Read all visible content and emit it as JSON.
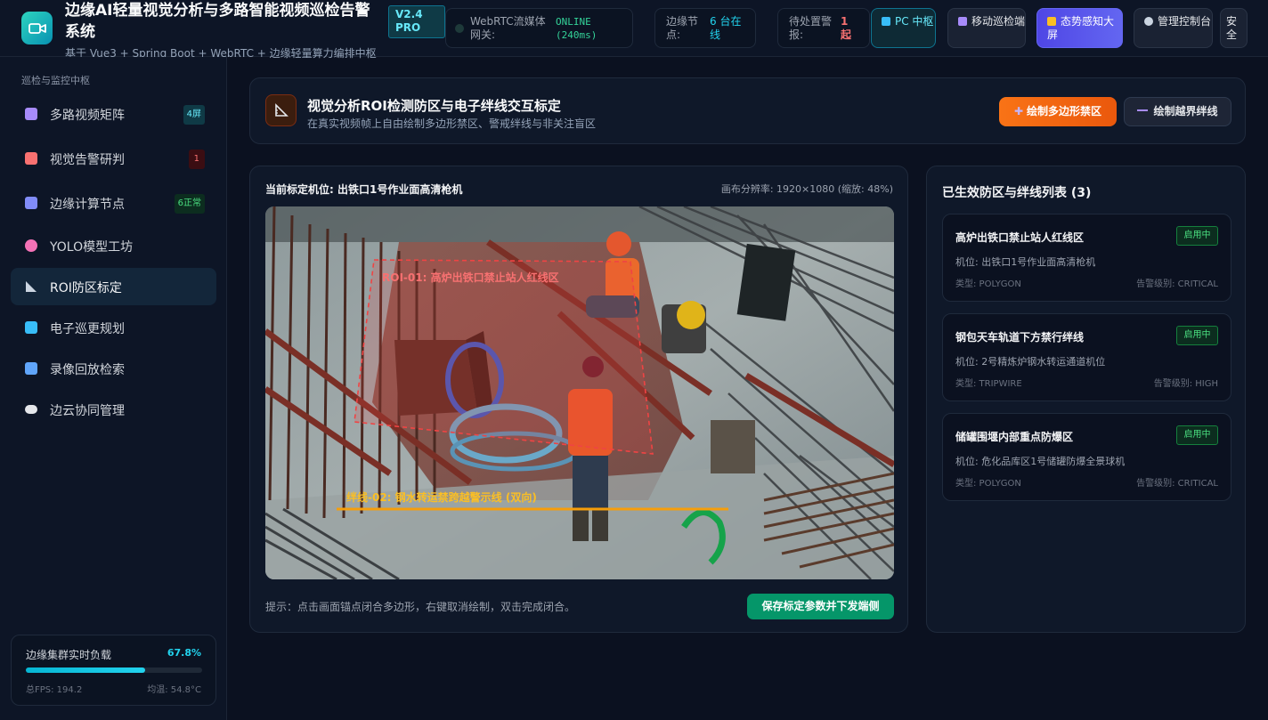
{
  "header": {
    "title": "边缘AI轻量视觉分析与多路智能视频巡检告警系统",
    "subtitle": "基于 Vue3 + Spring Boot + WebRTC + 边缘轻量算力编排中枢",
    "version": "V2.4 PRO",
    "status": {
      "webrtc_label": "WebRTC流媒体网关:",
      "webrtc_value": "ONLINE (240ms)",
      "edge_label": "边缘节点:",
      "edge_value": "6 台在线",
      "pending_label": "待处置警报:",
      "pending_value": "1 起"
    },
    "buttons": {
      "pc": "PC 中枢",
      "mobile": "移动巡检端",
      "dashboard": "态势感知大屏",
      "admin": "管理控制台",
      "security": "安全"
    }
  },
  "sidebar": {
    "section": "巡检与监控中枢",
    "items": [
      {
        "label": "多路视频矩阵",
        "badge": "4屏",
        "icon": "camera-icon",
        "color": "#a78bfa"
      },
      {
        "label": "视觉告警研判",
        "badge": "1",
        "icon": "alarm-siren-icon",
        "color": "#f87171"
      },
      {
        "label": "边缘计算节点",
        "badge": "6正常",
        "icon": "phone-device-icon",
        "color": "#818cf8"
      },
      {
        "label": "YOLO模型工坊",
        "badge": "",
        "icon": "brain-icon",
        "color": "#f472b6"
      },
      {
        "label": "ROI防区标定",
        "badge": "",
        "icon": "triangle-ruler-icon",
        "color": "#cbd5e1"
      },
      {
        "label": "电子巡更规划",
        "badge": "",
        "icon": "map-icon",
        "color": "#38bdf8"
      },
      {
        "label": "录像回放检索",
        "badge": "",
        "icon": "rewind-icon",
        "color": "#60a5fa"
      },
      {
        "label": "边云协同管理",
        "badge": "",
        "icon": "cloud-icon",
        "color": "#e5e7eb"
      }
    ],
    "load": {
      "title": "边缘集群实时负载",
      "percent_text": "67.8%",
      "percent": 67.8,
      "fps": "总FPS: 194.2",
      "temp": "均温: 54.8°C"
    }
  },
  "roi": {
    "title": "视觉分析ROI检测防区与电子绊线交互标定",
    "subtitle": "在真实视频帧上自由绘制多边形禁区、警戒绊线与非关注盲区",
    "draw_polygon": "绘制多边形禁区",
    "draw_line": "绘制越界绊线"
  },
  "canvas": {
    "camera": "当前标定机位: 出铁口1号作业面高清枪机",
    "resolution": "画布分辨率: 1920×1080 (缩放: 48%)",
    "roi_label": "ROI-01: 高炉出铁口禁止站人红线区",
    "line_label": "绊线-02: 钢水转运禁跨越警示线 (双向)",
    "hint": "提示：点击画面锚点闭合多边形，右键取消绘制，双击完成闭合。",
    "save": "保存标定参数并下发端侧"
  },
  "zones": {
    "title": "已生效防区与绊线列表 (3)",
    "items": [
      {
        "name": "高炉出铁口禁止站人红线区",
        "status": "启用中",
        "location": "机位: 出铁口1号作业面高清枪机",
        "type": "类型: POLYGON",
        "level": "告警级别: CRITICAL"
      },
      {
        "name": "钢包天车轨道下方禁行绊线",
        "status": "启用中",
        "location": "机位: 2号精炼炉钢水转运通道机位",
        "type": "类型: TRIPWIRE",
        "level": "告警级别: HIGH"
      },
      {
        "name": "储罐围堰内部重点防爆区",
        "status": "启用中",
        "location": "机位: 危化品库区1号储罐防爆全景球机",
        "type": "类型: POLYGON",
        "level": "告警级别: CRITICAL"
      }
    ]
  },
  "colors": {
    "accent": "#22d3ee",
    "orange": "#f97316",
    "green": "#059669",
    "roi_red": "#ef4444",
    "tripwire": "#f59e0b"
  }
}
